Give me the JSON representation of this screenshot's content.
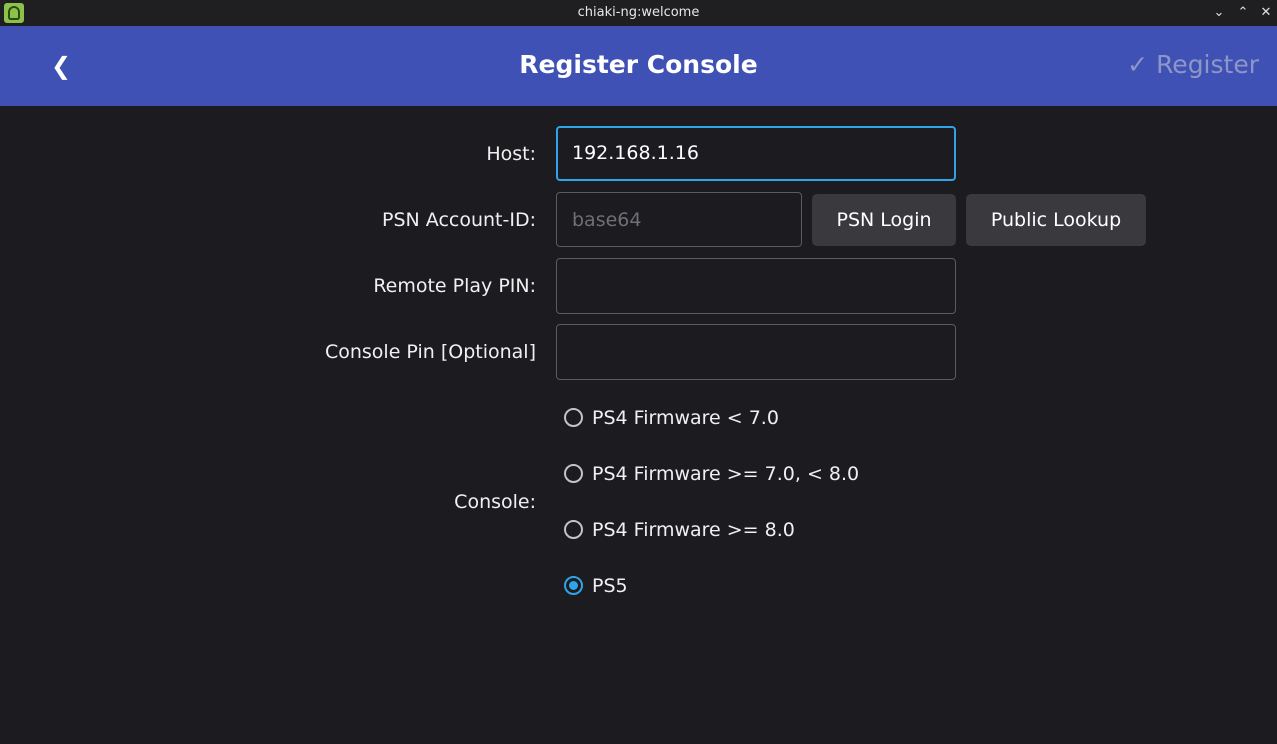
{
  "window": {
    "title": "chiaki-ng:welcome",
    "controls": {
      "minimize": "⌄",
      "maximize": "⌃",
      "close": "✕"
    }
  },
  "header": {
    "back_icon": "❮",
    "title": "Register Console",
    "register_check": "✓",
    "register_label": "Register",
    "background_color": "#3f51b5"
  },
  "form": {
    "host": {
      "label": "Host:",
      "value": "192.168.1.16"
    },
    "psn_account_id": {
      "label": "PSN Account-ID:",
      "value": "",
      "placeholder": "base64"
    },
    "psn_login_button": "PSN Login",
    "public_lookup_button": "Public Lookup",
    "remote_play_pin": {
      "label": "Remote Play PIN:",
      "value": ""
    },
    "console_pin": {
      "label": "Console Pin [Optional]",
      "value": ""
    },
    "console": {
      "label": "Console:",
      "options": [
        {
          "label": "PS4 Firmware < 7.0",
          "selected": false
        },
        {
          "label": "PS4 Firmware >= 7.0, < 8.0",
          "selected": false
        },
        {
          "label": "PS4 Firmware >= 8.0",
          "selected": false
        },
        {
          "label": "PS5",
          "selected": true
        }
      ]
    }
  },
  "colors": {
    "accent": "#2fa4e7",
    "background": "#1c1b1f"
  }
}
